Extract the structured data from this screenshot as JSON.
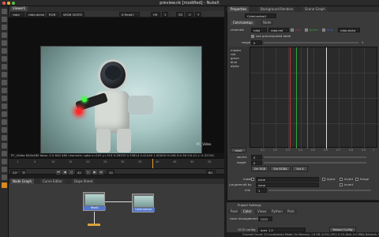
{
  "window": {
    "title": "preview.nk [modified] - NukeX"
  },
  "viewer": {
    "tab": "Viewer1",
    "controls": {
      "channels": "rgba",
      "layer": "rgba.alpha",
      "display": "RGB",
      "colorspace": "sRGB (ACES)",
      "node_a": "A  Read1",
      "frame_field": "f/8",
      "zoom": "1",
      "frame": "-2",
      "view": "Y",
      "proxy": "2D"
    },
    "format_label": "PC_Video",
    "info": "PC_Video 640x480  bbox: 0 0 640 480  channels: rgba  x=203 y=314      0.26333  0.33814  0.41040  1.00000   H:206 S:0.36 V:0.41   L: 0.32744",
    "timeline": {
      "ticks": [
        "1",
        "5",
        "10",
        "15",
        "20",
        "25",
        "30",
        "35",
        "40",
        "45",
        "50",
        "55"
      ],
      "current": "42"
    },
    "transport": {
      "fps": "24*",
      "mode": "TF",
      "frame": "42",
      "inc": "10",
      "end": "60"
    }
  },
  "nodegraph": {
    "tabs": [
      "Node Graph",
      "Curve Editor",
      "Dope Sheet"
    ],
    "nodes": [
      {
        "name": "Read1",
        "sub": "grade.mov"
      },
      {
        "name": "ColorLookup1"
      }
    ]
  },
  "properties": {
    "tabs": [
      "Properties",
      "Background Renders",
      "Scene Graph"
    ],
    "node_name": "ColorLookup1",
    "tab": "ColorLookup",
    "node_tab": "Node",
    "channels_label": "channels",
    "channels_value": "rgba",
    "channel_toggles": [
      "rgba.red",
      "red",
      "green",
      "blue",
      "rgba.alpha"
    ],
    "channel_colors": [
      "#c63030",
      "#2fa83a",
      "#3a5fd0",
      "#dddddd"
    ],
    "use_precomputed": "use precomputed table",
    "range_label": "range",
    "range_value": "0",
    "range_end": "1",
    "legend": [
      "master",
      "red",
      "green",
      "blue",
      "alpha"
    ],
    "source_label": "source",
    "source_value": "0",
    "target_label": "target",
    "target_value": "0",
    "set_buttons": [
      "Set RGB",
      "Set RGBA",
      "Set A"
    ],
    "mask_label": "mask",
    "mask_value": "none",
    "inject": "inject",
    "invert": "invert",
    "fringe": "fringe",
    "unpremult_label": "(un)premult by",
    "unpremult_value": "none",
    "invert2": "invert",
    "mix_label": "mix",
    "mix_value": "1",
    "reset": "reset",
    "x_ticks": [
      "0.1",
      "0.2",
      "0.3",
      "0.4",
      "0.5",
      "0.6",
      "0.7",
      "0.8",
      "0.9",
      "1"
    ]
  },
  "project": {
    "title": "Project Settings",
    "tabs": [
      "Root",
      "Color",
      "Views",
      "Python",
      "Pork"
    ],
    "color_management_label": "color management",
    "color_management_value": "OCIO",
    "ocio_label": "OCIO config",
    "ocio_value": "aces_1.2",
    "reload": "Reload Config"
  },
  "status": "Channel Count: 10  Localization Mode: On  Memory: 1.8 GB (5.0%)  CPU: 0.1%  Disk: 0.0 MB/s  Network: 0.0 MB/s"
}
